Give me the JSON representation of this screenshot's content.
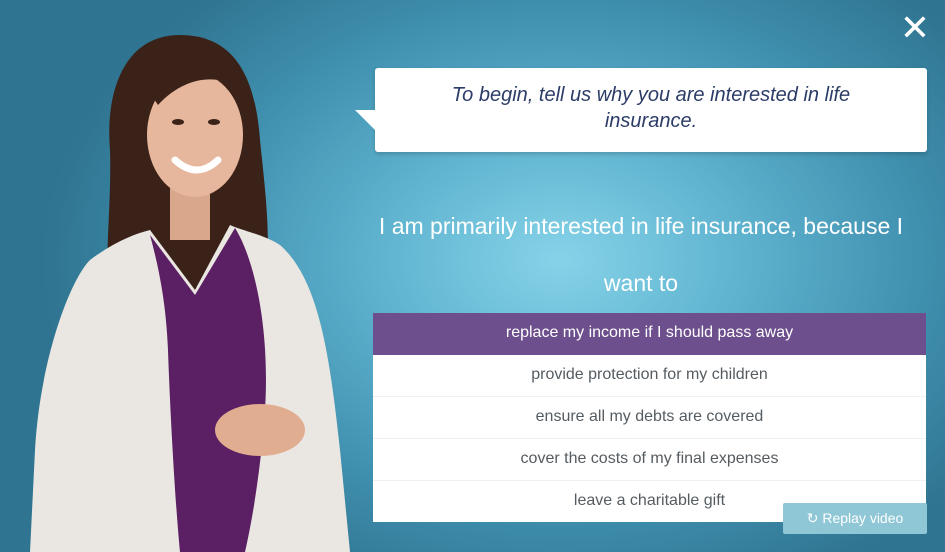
{
  "dialog": {
    "close_icon": "close-icon",
    "bubble_text": "To begin, tell us why you are interested in life insurance.",
    "prompt_line1": "I am primarily interested in life insurance, because I",
    "prompt_line2": "want to",
    "options": [
      {
        "label": "replace my income if I should pass away",
        "selected": true
      },
      {
        "label": "provide protection for my children",
        "selected": false
      },
      {
        "label": "ensure all my debts are covered",
        "selected": false
      },
      {
        "label": "cover the costs of my final expenses",
        "selected": false
      },
      {
        "label": "leave a charitable gift",
        "selected": false
      }
    ],
    "replay_label": "Replay video",
    "replay_icon": "replay-icon"
  },
  "colors": {
    "background_blue": "#5fb3cf",
    "selected_option": "#6d4f8d",
    "bubble_text": "#2b3c67"
  }
}
